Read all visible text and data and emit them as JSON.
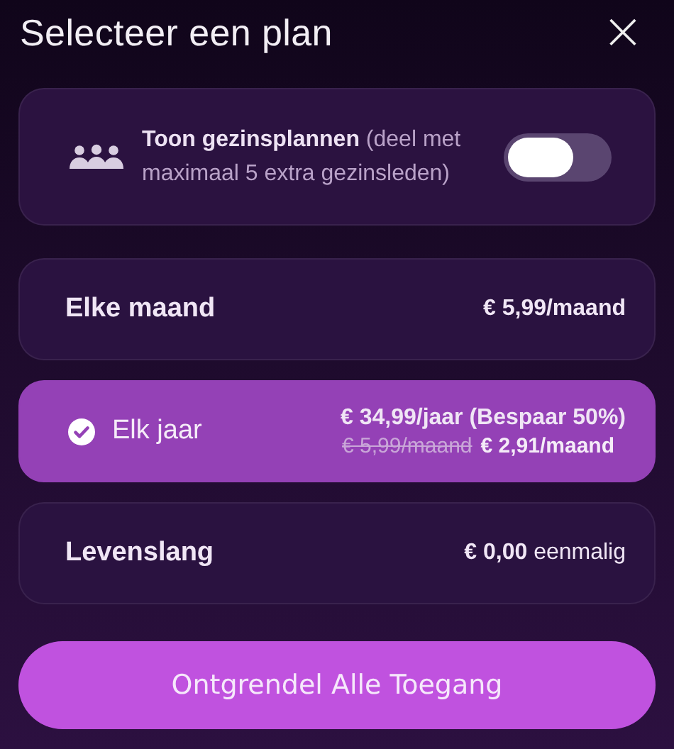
{
  "title": "Selecteer een plan",
  "close": "×",
  "family": {
    "text": "**Toon gezinsplannen** (deel met maximaal 5 extra gezinsleden)",
    "on": false
  },
  "plans": [
    {
      "label": "Elke maand",
      "selected": false,
      "price": "€ 5,99/maand"
    },
    {
      "label": "Elk jaar",
      "selected": true,
      "price": "€ 34,99/jaar (Bespaar 50%)",
      "old_price": "€ 5,99/maand",
      "monthly_price": "€ 2,91/maand"
    },
    {
      "label": "Levenslang",
      "selected": false,
      "price": "**€ 0,00** eenmalig"
    }
  ],
  "button": "Ontgrendel Alle Toegang"
}
